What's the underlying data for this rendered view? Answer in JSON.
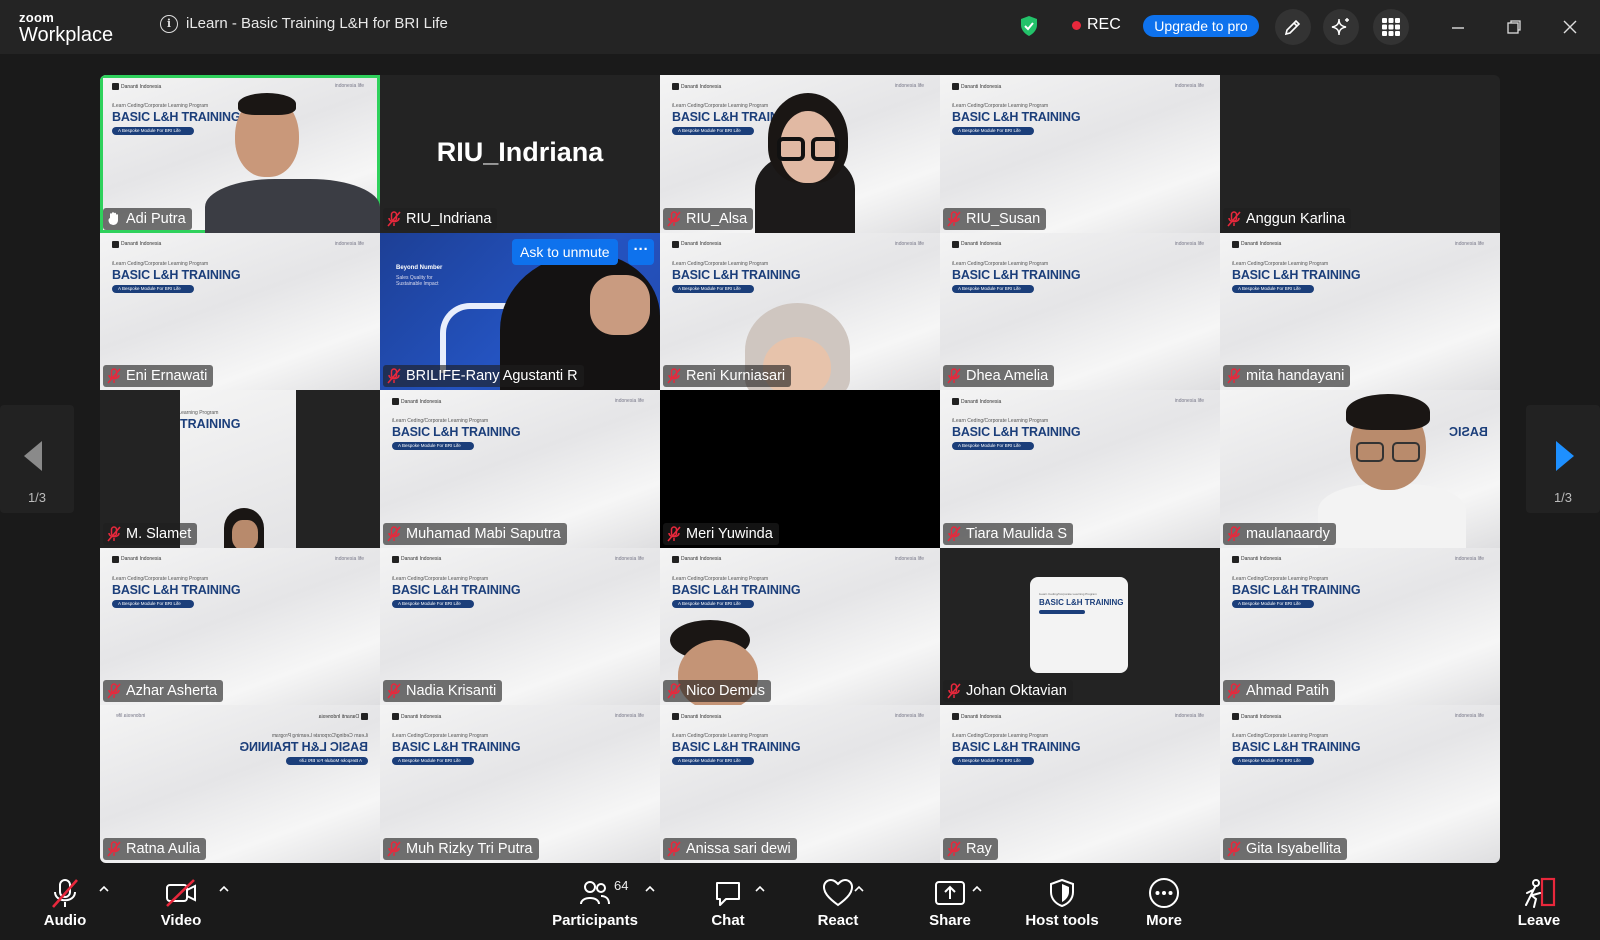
{
  "app": {
    "brand_line1": "zoom",
    "brand_line2": "Workplace"
  },
  "meeting": {
    "title": "iLearn - Basic Training L&H for BRI Life"
  },
  "header": {
    "rec_label": "REC",
    "upgrade_label": "Upgrade to pro"
  },
  "slide": {
    "logo_text": "Dananti Indonesia",
    "partner_text": "indonesia life",
    "subtitle": "iLearn Ceding/Corporate Learning Program",
    "headline": "BASIC L&H TRAINING",
    "pill": "A Bespoke Module For BRI Life"
  },
  "blue_slide": {
    "title": "Beyond Number",
    "subtitle": "Sales Quality for Sustainable Impact"
  },
  "participants": [
    {
      "name": "Adi Putra"
    },
    {
      "name": "RIU_Indriana",
      "big_name": "RIU_Indriana"
    },
    {
      "name": "RIU_Alsa"
    },
    {
      "name": "RIU_Susan"
    },
    {
      "name": "Anggun Karlina"
    },
    {
      "name": "Eni Ernawati"
    },
    {
      "name": "BRILIFE-Rany Agustanti R",
      "unmute_label": "Ask to unmute",
      "more_label": "···"
    },
    {
      "name": "Reni Kurniasari"
    },
    {
      "name": "Dhea Amelia"
    },
    {
      "name": "mita handayani"
    },
    {
      "name": "M. Slamet"
    },
    {
      "name": "Muhamad Mabi Saputra"
    },
    {
      "name": "Meri Yuwinda"
    },
    {
      "name": "Tiara Maulida S"
    },
    {
      "name": "maulanaardy"
    },
    {
      "name": "Azhar Asherta"
    },
    {
      "name": "Nadia Krisanti"
    },
    {
      "name": "Nico Demus"
    },
    {
      "name": "Johan Oktavian"
    },
    {
      "name": "Ahmad Patih"
    },
    {
      "name": "Ratna Aulia"
    },
    {
      "name": "Muh Rizky Tri Putra"
    },
    {
      "name": "Anissa sari dewi"
    },
    {
      "name": "Ray"
    },
    {
      "name": "Gita Isyabellita"
    }
  ],
  "pagination": {
    "left_label": "1/3",
    "right_label": "1/3"
  },
  "toolbar": {
    "audio": "Audio",
    "video": "Video",
    "participants": "Participants",
    "participants_count": "64",
    "chat": "Chat",
    "react": "React",
    "share": "Share",
    "host_tools": "Host tools",
    "more": "More",
    "leave": "Leave"
  },
  "colors": {
    "accent": "#0e72ed",
    "active_speaker": "#2fd15c",
    "rec": "#e8283c",
    "muted": "#e8283c",
    "slide_headline": "#1b3e7a"
  }
}
